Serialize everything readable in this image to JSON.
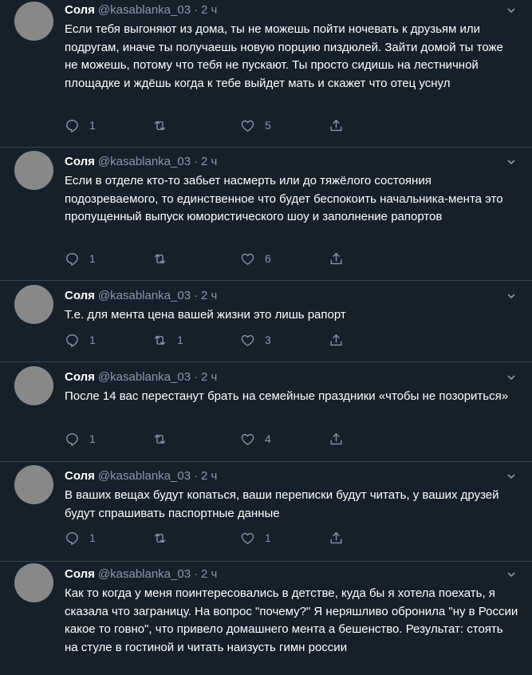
{
  "author": {
    "name": "Соля",
    "handle": "@kasablanka_03",
    "separator": "·"
  },
  "tweets": [
    {
      "time": "2 ч",
      "text": "Если тебя выгоняют из дома, ты не можешь пойти ночевать к друзьям или подругам, иначе ты получаешь новую порцию пиздюлей. Зайти домой ты тоже не можешь, потому что тебя не пускают. Ты просто сидишь на лестничной площадке и ждёшь когда к тебе выйдет мать и скажет что отец уснул",
      "replies": "1",
      "retweets": "",
      "likes": "5"
    },
    {
      "time": "2 ч",
      "text": "Если в отделе кто-то забьет насмерть или до тяжёлого состояния подозреваемого, то единственное что будет беспокоить начальника-мента это пропущенный выпуск юмористического шоу и заполнение рапортов",
      "replies": "1",
      "retweets": "",
      "likes": "6"
    },
    {
      "time": "2 ч",
      "text": "Т.е. для мента цена вашей жизни это лишь рапорт",
      "replies": "1",
      "retweets": "1",
      "likes": "3"
    },
    {
      "time": "2 ч",
      "text": "После 14 вас перестанут брать на семейные праздники «чтобы не позориться»",
      "replies": "1",
      "retweets": "",
      "likes": "4"
    },
    {
      "time": "2 ч",
      "text": "В ваших вещах будут копаться, ваши переписки будут читать, у ваших друзей будут спрашивать паспортные данные",
      "replies": "1",
      "retweets": "",
      "likes": "1"
    },
    {
      "time": "2 ч",
      "text": "Как то когда у меня поинтересовались в детстве, куда бы я хотела поехать, я сказала что заграницу. На вопрос \"почему?\" Я неряшливо обронила \"ну в России какое то говно\", что привело домашнего мента а бешенство. Результат: стоять на стуле в гостиной и читать наизусть гимн россии",
      "replies": "",
      "retweets": "",
      "likes": ""
    }
  ],
  "icons": {
    "reply": "reply-icon",
    "retweet": "retweet-icon",
    "like": "like-icon",
    "share": "share-icon",
    "menu": "chevron-down-icon"
  },
  "colors": {
    "background": "#15202b",
    "text": "#ffffff",
    "secondary": "#8899a6",
    "divider": "#38444d",
    "avatar": "#888888"
  }
}
